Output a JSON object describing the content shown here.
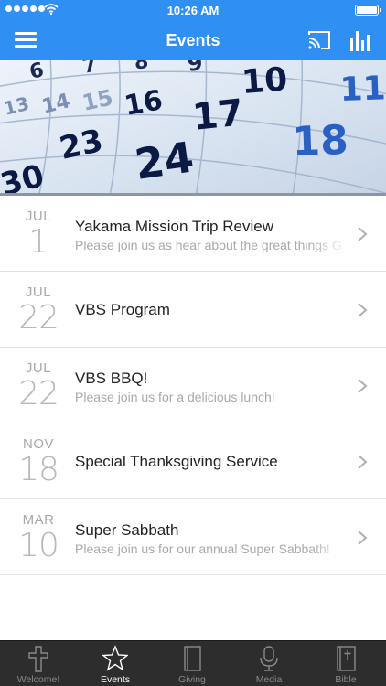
{
  "status": {
    "time": "10:26 AM"
  },
  "header": {
    "title": "Events"
  },
  "events": [
    {
      "month": "JUL",
      "day": "1",
      "title": "Yakama Mission Trip Review",
      "description": "Please join us as hear about the great things G"
    },
    {
      "month": "JUL",
      "day": "22",
      "title": "VBS Program",
      "description": ""
    },
    {
      "month": "JUL",
      "day": "22",
      "title": "VBS BBQ!",
      "description": "Please join us for a delicious lunch!"
    },
    {
      "month": "NOV",
      "day": "18",
      "title": "Special Thanksgiving Service",
      "description": ""
    },
    {
      "month": "MAR",
      "day": "10",
      "title": "Super Sabbath",
      "description": "Please join us for our annual Super Sabbath!"
    }
  ],
  "banner": {
    "numbers": [
      "6",
      "7",
      "8",
      "9",
      "10",
      "11",
      "13",
      "14",
      "15",
      "16",
      "17",
      "18",
      "23",
      "24",
      "30"
    ]
  },
  "tabbar": {
    "tabs": [
      {
        "label": "Welcome!",
        "icon": "cross-icon"
      },
      {
        "label": "Events",
        "icon": "star-icon",
        "active": true
      },
      {
        "label": "Giving",
        "icon": "book-icon"
      },
      {
        "label": "Media",
        "icon": "microphone-icon"
      },
      {
        "label": "Bible",
        "icon": "bible-icon"
      }
    ]
  },
  "colors": {
    "accent": "#2f8ff2",
    "tabbar": "#2d2d2d"
  }
}
